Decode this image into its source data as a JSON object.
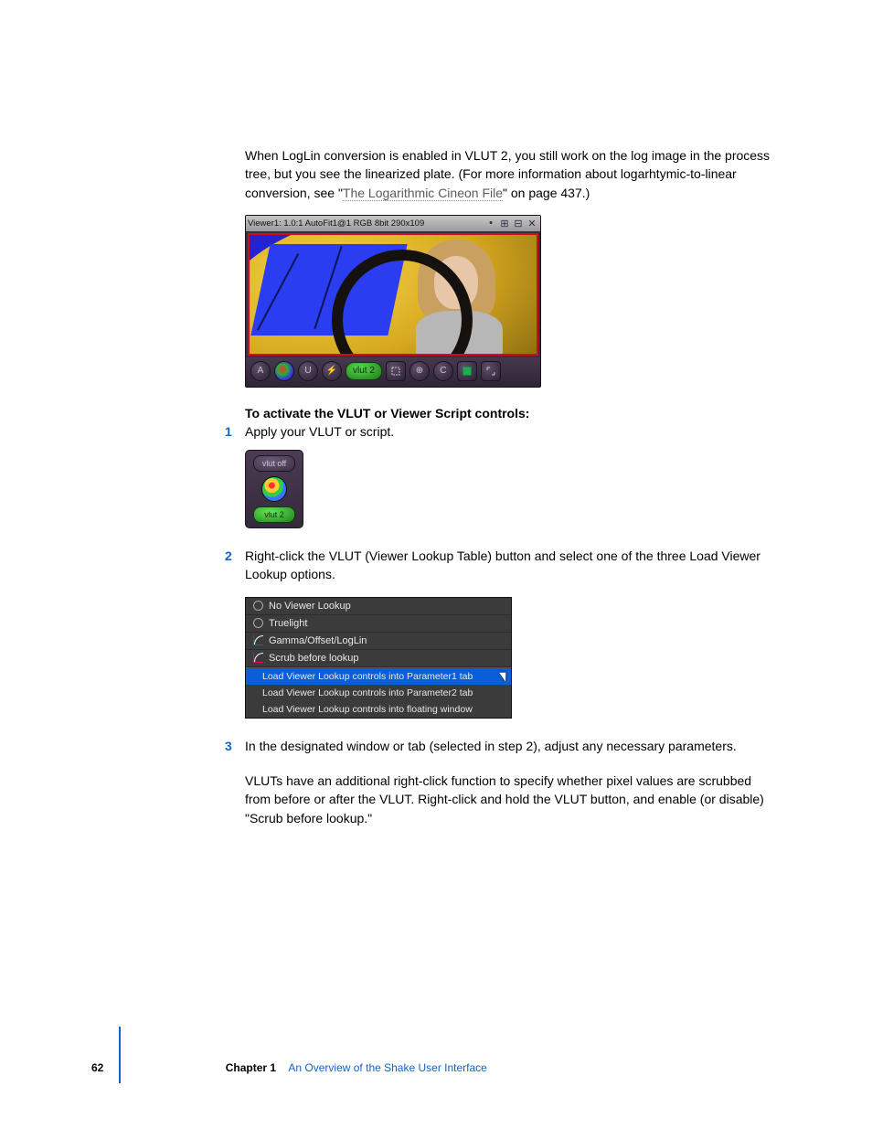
{
  "intro": {
    "text_before_link": "When LogLin conversion is enabled in VLUT 2, you still work on the log image in the process tree, but you see the linearized plate. (For more information about logarhtymic-to-linear conversion, see \"",
    "link_text": "The Logarithmic Cineon File",
    "text_after_link": "\" on page 437.)"
  },
  "viewer": {
    "title": "Viewer1: 1.0:1 AutoFit1@1 RGB 8bit 290x109",
    "toolbar": {
      "a_label": "A",
      "u_label": "U",
      "vlut_label": "vlut 2",
      "c_label": "C"
    }
  },
  "heading": "To activate the VLUT or Viewer Script controls:",
  "steps": {
    "s1_num": "1",
    "s1_text": "Apply your VLUT or script.",
    "s2_num": "2",
    "s2_text": "Right-click the VLUT (Viewer Lookup Table) button and select one of the three Load Viewer Lookup options.",
    "s3_num": "3",
    "s3_text": "In the designated window or tab (selected in step 2), adjust any necessary parameters."
  },
  "vlut_panel": {
    "off_label": "vlut off",
    "on_label": "vlut 2"
  },
  "context_menu": {
    "item1": "No Viewer Lookup",
    "item2": "Truelight",
    "item3": "Gamma/Offset/LogLin",
    "item4": "Scrub before lookup",
    "sub1": "Load Viewer Lookup controls into Parameter1 tab",
    "sub2": "Load Viewer Lookup controls into Parameter2 tab",
    "sub3": "Load Viewer Lookup controls into floating window"
  },
  "closing": "VLUTs have an additional right-click function to specify whether pixel values are scrubbed from before or after the VLUT. Right-click and hold the VLUT button, and enable (or disable) \"Scrub before lookup.\"",
  "footer": {
    "page": "62",
    "chapter_label": "Chapter 1",
    "chapter_title": "An Overview of the Shake User Interface"
  }
}
